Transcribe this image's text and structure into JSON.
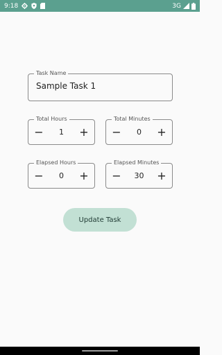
{
  "status_bar": {
    "time": "9:18",
    "network": "3G",
    "color": "#5ba08f",
    "icons": [
      "gear-icon",
      "shield-icon",
      "sd-card-icon",
      "signal-icon",
      "battery-icon"
    ]
  },
  "form": {
    "task_name": {
      "label": "Task Name",
      "value": "Sample Task 1"
    },
    "total_hours": {
      "label": "Total Hours",
      "value": "1"
    },
    "total_minutes": {
      "label": "Total Minutes",
      "value": "0"
    },
    "elapsed_hours": {
      "label": "Elapsed Hours",
      "value": "0"
    },
    "elapsed_minutes": {
      "label": "Elapsed Minutes",
      "value": "30"
    },
    "decrement_glyph": "−",
    "increment_glyph": "+"
  },
  "actions": {
    "update_label": "Update Task",
    "button_color": "#c2e0d4"
  }
}
